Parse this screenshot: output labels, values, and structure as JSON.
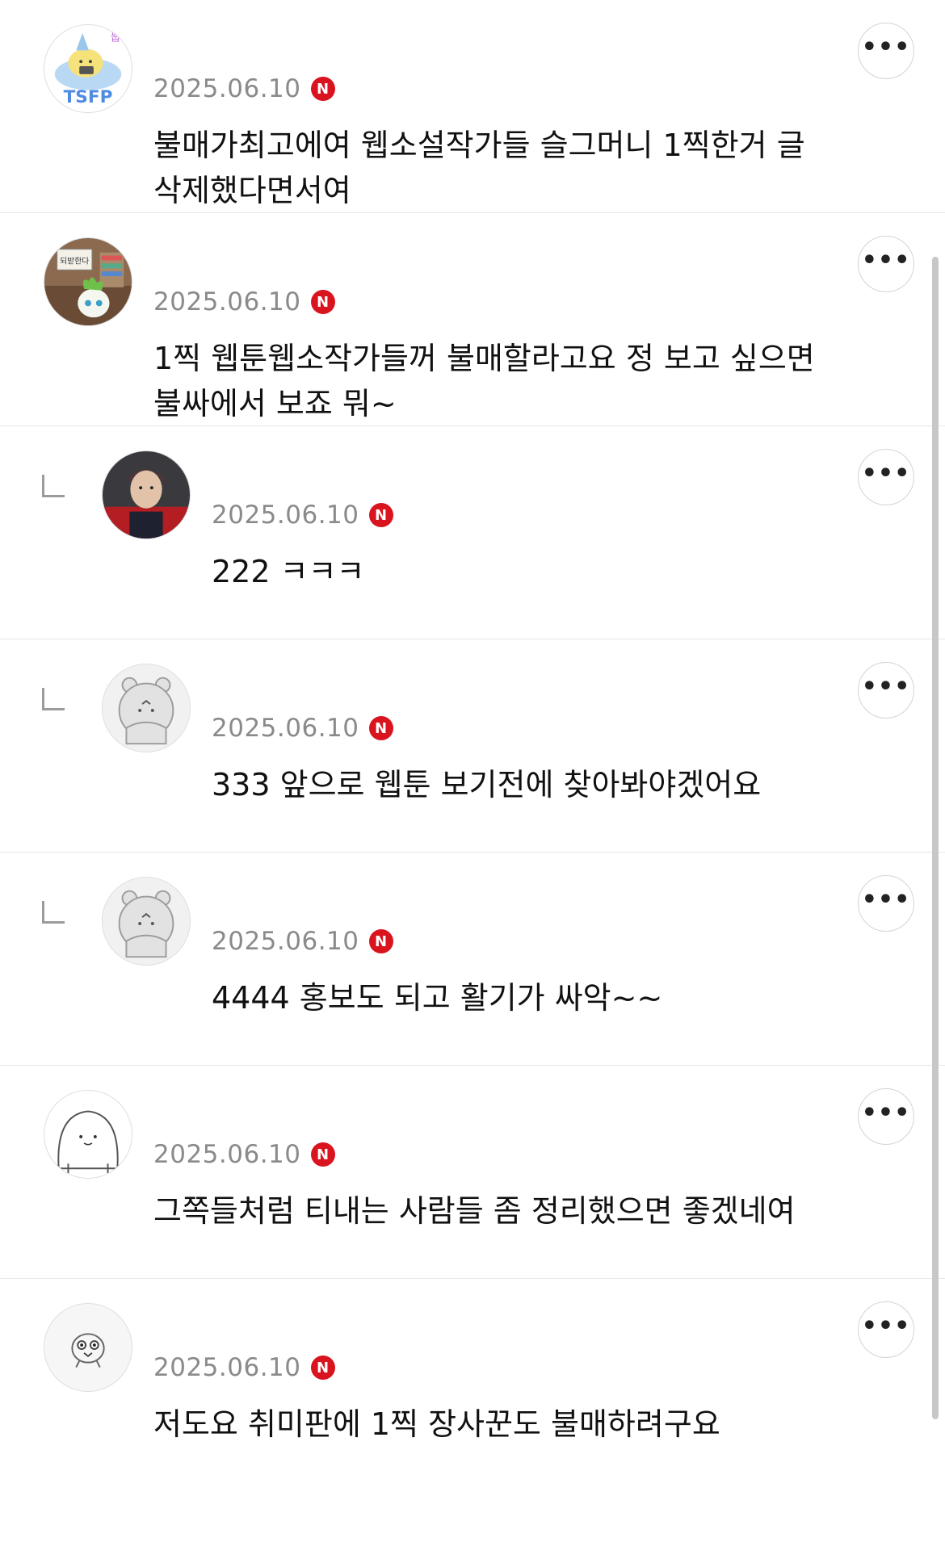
{
  "comments": [
    {
      "author": "",
      "date": "2025.06.10",
      "badge": "N",
      "text": "불매가최고에여 웹소설작가들 슬그머니 1찍한거 글 삭제했다면서여",
      "is_reply": false,
      "avatar_icon": "tsfp-character-avatar",
      "avatar_text": "TSFP",
      "avatar_caption": "눕눕",
      "more_icon": "more-options-icon"
    },
    {
      "author": "",
      "date": "2025.06.10",
      "badge": "N",
      "text": "1찍 웹툰웹소작가들꺼 불매할라고요 정 보고 싶으면 불싸에서 보죠 뭐~",
      "is_reply": false,
      "avatar_icon": "plant-character-avatar",
      "avatar_sign": "되받한다",
      "more_icon": "more-options-icon"
    },
    {
      "author": "",
      "date": "2025.06.10",
      "badge": "N",
      "text": "222 ㅋㅋㅋ",
      "is_reply": true,
      "avatar_icon": "person-photo-avatar",
      "more_icon": "more-options-icon"
    },
    {
      "author": "",
      "date": "2025.06.10",
      "badge": "N",
      "text": "333 앞으로 웹툰 보기전에 찾아봐야겠어요",
      "is_reply": true,
      "avatar_icon": "hamster-default-avatar",
      "more_icon": "more-options-icon"
    },
    {
      "author": "",
      "date": "2025.06.10",
      "badge": "N",
      "text": "4444 홍보도 되고 활기가 싸악~~",
      "is_reply": true,
      "avatar_icon": "hamster-default-avatar",
      "more_icon": "more-options-icon"
    },
    {
      "author": "",
      "date": "2025.06.10",
      "badge": "N",
      "text": "그쪽들처럼 티내는 사람들 좀 정리했으면 좋겠네여",
      "is_reply": false,
      "avatar_icon": "blob-character-avatar",
      "more_icon": "more-options-icon"
    },
    {
      "author": "",
      "date": "2025.06.10",
      "badge": "N",
      "text": "저도요 취미판에 1찍 장사꾼도 불매하려구요",
      "is_reply": false,
      "avatar_icon": "bird-character-avatar",
      "more_icon": "more-options-icon"
    }
  ],
  "colors": {
    "badge_red": "#d9141e",
    "date_gray": "#8a8a8a",
    "divider": "#e6e6e6"
  }
}
